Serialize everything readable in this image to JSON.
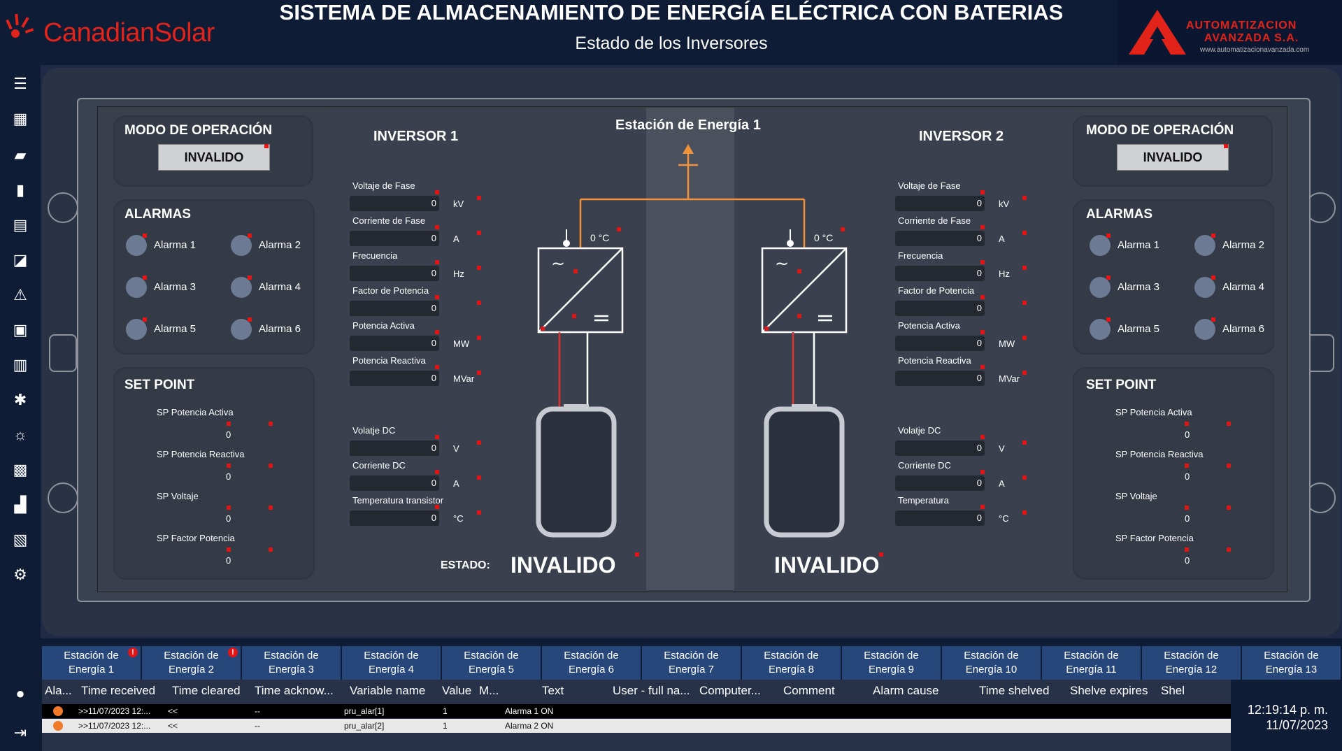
{
  "header": {
    "title": "SISTEMA DE ALMACENAMIENTO DE ENERGÍA ELÉCTRICA CON BATERIAS",
    "subtitle": "Estado de los Inversores",
    "left_logo": "CanadianSolar",
    "right_logo_line1": "AUTOMATIZACION",
    "right_logo_line2": "AVANZADA S.A.",
    "right_logo_url": "www.automatizacionavanzada.com"
  },
  "sidebar": {
    "icons": [
      "list-icon",
      "dashboard-icon",
      "battery-icon",
      "power-meter-icon",
      "solar-panel-icon",
      "chart-icon",
      "alarm-icon",
      "clipboard-icon",
      "bar-chart-icon",
      "wind-turbine-icon",
      "weather-icon",
      "grid-icon",
      "building-icon",
      "inverter-icon",
      "gear-icon"
    ],
    "bottom_icons": [
      "user-icon",
      "logout-icon"
    ]
  },
  "station_title": "Estación de Energía 1",
  "left": {
    "mode_title": "MODO DE OPERACIÓN",
    "mode_value": "INVALIDO",
    "alarms_title": "ALARMAS",
    "alarms": [
      "Alarma 1",
      "Alarma 2",
      "Alarma 3",
      "Alarma 4",
      "Alarma 5",
      "Alarma 6"
    ],
    "setpoint_title": "SET POINT",
    "setpoints": [
      {
        "label": "SP Potencia Activa",
        "value": "0"
      },
      {
        "label": "SP Potencia Reactiva",
        "value": "0"
      },
      {
        "label": "SP Voltaje",
        "value": "0"
      },
      {
        "label": "SP Factor Potencia",
        "value": "0"
      }
    ]
  },
  "right": {
    "mode_title": "MODO DE OPERACIÓN",
    "mode_value": "INVALIDO",
    "alarms_title": "ALARMAS",
    "alarms": [
      "Alarma 1",
      "Alarma 2",
      "Alarma 3",
      "Alarma 4",
      "Alarma 5",
      "Alarma 6"
    ],
    "setpoint_title": "SET POINT",
    "setpoints": [
      {
        "label": "SP Potencia Activa",
        "value": "0"
      },
      {
        "label": "SP Potencia Reactiva",
        "value": "0"
      },
      {
        "label": "SP Voltaje",
        "value": "0"
      },
      {
        "label": "SP Factor Potencia",
        "value": "0"
      }
    ]
  },
  "inv1": {
    "title": "INVERSOR 1",
    "temp": "0 °C",
    "estado_label": "ESTADO:",
    "estado_value": "INVALIDO",
    "vars": [
      {
        "label": "Voltaje de Fase",
        "value": "0",
        "unit": "kV"
      },
      {
        "label": "Corriente de Fase",
        "value": "0",
        "unit": "A"
      },
      {
        "label": "Frecuencia",
        "value": "0",
        "unit": "Hz"
      },
      {
        "label": "Factor de Potencia",
        "value": "0",
        "unit": ""
      },
      {
        "label": "Potencia Activa",
        "value": "0",
        "unit": "MW"
      },
      {
        "label": "Potencia Reactiva",
        "value": "0",
        "unit": "MVar"
      },
      {
        "label": "Volatje DC",
        "value": "0",
        "unit": "V"
      },
      {
        "label": "Corriente DC",
        "value": "0",
        "unit": "A"
      },
      {
        "label": "Temperatura transistor",
        "value": "0",
        "unit": "°C"
      }
    ]
  },
  "inv2": {
    "title": "INVERSOR 2",
    "temp": "0 °C",
    "estado_value": "INVALIDO",
    "vars": [
      {
        "label": "Voltaje de Fase",
        "value": "0",
        "unit": "kV"
      },
      {
        "label": "Corriente de Fase",
        "value": "0",
        "unit": "A"
      },
      {
        "label": "Frecuencia",
        "value": "0",
        "unit": "Hz"
      },
      {
        "label": "Factor de Potencia",
        "value": "0",
        "unit": ""
      },
      {
        "label": "Potencia Activa",
        "value": "0",
        "unit": "MW"
      },
      {
        "label": "Potencia Reactiva",
        "value": "0",
        "unit": "MVar"
      },
      {
        "label": "Volatje DC",
        "value": "0",
        "unit": "V"
      },
      {
        "label": "Corriente DC",
        "value": "0",
        "unit": "A"
      },
      {
        "label": "Temperatura",
        "value": "0",
        "unit": "°C"
      }
    ]
  },
  "tabs": [
    {
      "line1": "Estación de",
      "line2": "Energía 1",
      "badge": "!"
    },
    {
      "line1": "Estación de",
      "line2": "Energía 2",
      "badge": "!"
    },
    {
      "line1": "Estación de",
      "line2": "Energía 3",
      "badge": ""
    },
    {
      "line1": "Estación de",
      "line2": "Energía 4",
      "badge": ""
    },
    {
      "line1": "Estación de",
      "line2": "Energía 5",
      "badge": ""
    },
    {
      "line1": "Estación de",
      "line2": "Energía 6",
      "badge": ""
    },
    {
      "line1": "Estación de",
      "line2": "Energía 7",
      "badge": ""
    },
    {
      "line1": "Estación de",
      "line2": "Energía 8",
      "badge": ""
    },
    {
      "line1": "Estación de",
      "line2": "Energía 9",
      "badge": ""
    },
    {
      "line1": "Estación de",
      "line2": "Energía 10",
      "badge": ""
    },
    {
      "line1": "Estación de",
      "line2": "Energía 11",
      "badge": ""
    },
    {
      "line1": "Estación de",
      "line2": "Energía 12",
      "badge": ""
    },
    {
      "line1": "Estación de",
      "line2": "Energía 13",
      "badge": ""
    }
  ],
  "alarm_table": {
    "columns": [
      "Ala...",
      "Time received",
      "Time cleared",
      "Time acknow...",
      "Variable name",
      "Value",
      "M...",
      "Text",
      "User - full na...",
      "Computer...",
      "Comment",
      "Alarm cause",
      "Time shelved",
      "Shelve expires",
      "Shel"
    ],
    "rows": [
      {
        "time_received": ">>11/07/2023 12:...",
        "time_cleared": "<<",
        "time_ack": "--",
        "variable": "pru_alar[1]",
        "value": "1",
        "text": "Alarma 1 ON"
      },
      {
        "time_received": ">>11/07/2023 12:...",
        "time_cleared": "<<",
        "time_ack": "--",
        "variable": "pru_alar[2]",
        "value": "1",
        "text": "Alarma 2 ON"
      }
    ]
  },
  "clock": {
    "time": "12:19:14 p. m.",
    "date": "11/07/2023"
  },
  "colors": {
    "accent_orange": "#f0923a",
    "red": "#e01515",
    "tab_blue": "#27477a",
    "navy": "#0f1c36"
  }
}
